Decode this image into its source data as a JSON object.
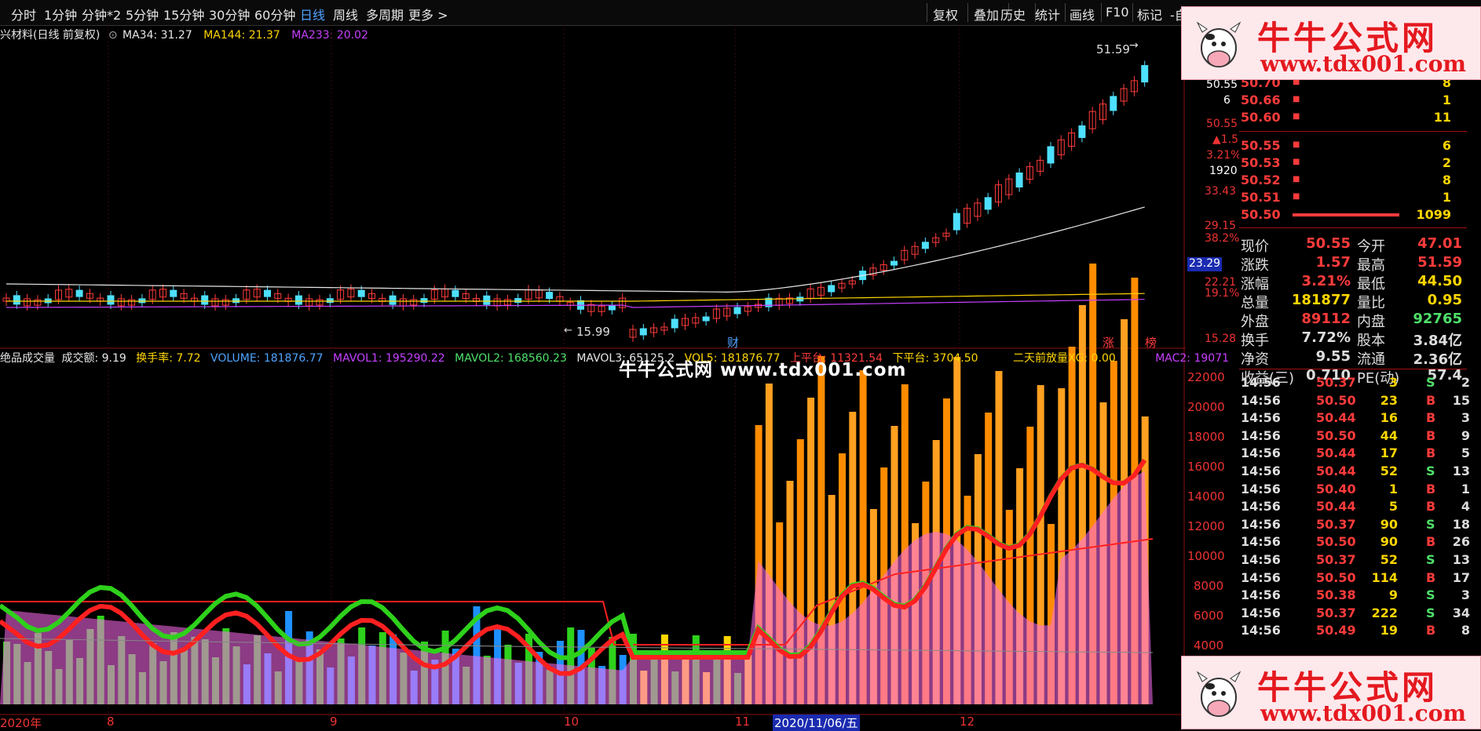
{
  "toolbar": {
    "timeframes": [
      "分时",
      "1分钟",
      "分钟*2",
      "5分钟",
      "15分钟",
      "30分钟",
      "60分钟",
      "日线",
      "周线",
      "多周期",
      "更多 >"
    ],
    "active_timeframe": "日线",
    "right_buttons": [
      "复权",
      "叠加",
      "历史",
      "统计",
      "画线",
      "F10",
      "标记",
      "-自"
    ]
  },
  "chart": {
    "stock_title": "兴材料(日线 前复权)",
    "ma34": "MA34: 31.27",
    "ma144": "MA144: 21.37",
    "ma233": "MA233: 20.02",
    "high_marker": "51.59",
    "low_marker": "15.99",
    "fin_marker": "财",
    "zhang_marker": "涨",
    "bang_marker": "榜",
    "price_axis": {
      "p1": "50.55",
      "p2": "6",
      "p3": "50.55",
      "p4": "▲1.57",
      "p5": "3.21%",
      "p6": "1920",
      "p7": "33.43",
      "p8": "29.15",
      "p9": "38.2%",
      "p10": "23.29",
      "p11": "22.21",
      "p12": "19.1%",
      "p13": "15.28"
    },
    "volume_info": {
      "name": "绝品成交量",
      "amount": "成交额: 9.19",
      "turnover": "换手率: 7.72",
      "volume": "VOLUME: 181876.77",
      "mavol1": "MAVOL1: 195290.22",
      "mavol2": "MAVOL2: 168560.23",
      "mavol3": "MAVOL3: 65125.2",
      "vol_extra": "VOL5: 181876.77",
      "upper_platform": "上平台: 11321.54",
      "lower_platform": "下平台: 3704.50",
      "xg": "二天前放量XG: 0.00",
      "mac2": "MAC2: 19071"
    },
    "vol_axis": [
      "22000",
      "20000",
      "18000",
      "16000",
      "14000",
      "12000",
      "10000",
      "8000",
      "6000",
      "4000"
    ],
    "x_axis": [
      "2020年",
      "8",
      "9",
      "10",
      "11",
      "2020/11/06/五",
      "12"
    ],
    "colors": {
      "up": "#ff3b3b",
      "down": "#4ee0ff",
      "ma34": "#e6e6e6",
      "ma144": "#ffd600",
      "ma233": "#c640ff"
    }
  },
  "orderbook": {
    "asks": [
      {
        "price": "50.70",
        "vol": "8"
      },
      {
        "price": "50.66",
        "vol": "1"
      },
      {
        "price": "50.60",
        "vol": "11"
      }
    ],
    "bids": [
      {
        "price": "50.55",
        "vol": "6"
      },
      {
        "price": "50.53",
        "vol": "2"
      },
      {
        "price": "50.52",
        "vol": "8"
      },
      {
        "price": "50.51",
        "vol": "1"
      },
      {
        "price": "50.50",
        "vol": "1099"
      }
    ]
  },
  "quote": [
    {
      "l": "现价",
      "v": "50.55",
      "vc": "#ff3b3b",
      "l2": "今开",
      "v2": "47.01",
      "v2c": "#ff3b3b"
    },
    {
      "l": "涨跌",
      "v": "1.57",
      "vc": "#ff3b3b",
      "l2": "最高",
      "v2": "51.59",
      "v2c": "#ff3b3b"
    },
    {
      "l": "涨幅",
      "v": "3.21%",
      "vc": "#ff3b3b",
      "l2": "最低",
      "v2": "44.50",
      "v2c": "#ffd600"
    },
    {
      "l": "总量",
      "v": "181877",
      "vc": "#ffd600",
      "l2": "量比",
      "v2": "0.95",
      "v2c": "#ffd600"
    },
    {
      "l": "外盘",
      "v": "89112",
      "vc": "#ff3b3b",
      "l2": "内盘",
      "v2": "92765",
      "v2c": "#4ee06a"
    },
    {
      "l": "换手",
      "v": "7.72%",
      "vc": "#ddd",
      "l2": "股本",
      "v2": "3.84亿",
      "v2c": "#ddd"
    },
    {
      "l": "净资",
      "v": "9.55",
      "vc": "#ddd",
      "l2": "流通",
      "v2": "2.36亿",
      "v2c": "#ddd"
    },
    {
      "l": "收益(三)",
      "v": "0.710",
      "vc": "#ddd",
      "l2": "PE(动)",
      "v2": "57.4",
      "v2c": "#ddd"
    }
  ],
  "ticks": [
    {
      "t": "14:56",
      "p": "50.37",
      "v": "3",
      "bs": "S",
      "n": "2"
    },
    {
      "t": "14:56",
      "p": "50.50",
      "v": "23",
      "bs": "B",
      "n": "15"
    },
    {
      "t": "14:56",
      "p": "50.44",
      "v": "16",
      "bs": "B",
      "n": "3"
    },
    {
      "t": "14:56",
      "p": "50.50",
      "v": "44",
      "bs": "B",
      "n": "9"
    },
    {
      "t": "14:56",
      "p": "50.44",
      "v": "17",
      "bs": "B",
      "n": "5"
    },
    {
      "t": "14:56",
      "p": "50.44",
      "v": "52",
      "bs": "S",
      "n": "13"
    },
    {
      "t": "14:56",
      "p": "50.40",
      "v": "1",
      "bs": "B",
      "n": "1"
    },
    {
      "t": "14:56",
      "p": "50.44",
      "v": "5",
      "bs": "B",
      "n": "4"
    },
    {
      "t": "14:56",
      "p": "50.37",
      "v": "90",
      "bs": "S",
      "n": "18"
    },
    {
      "t": "14:56",
      "p": "50.50",
      "v": "90",
      "bs": "B",
      "n": "26"
    },
    {
      "t": "14:56",
      "p": "50.37",
      "v": "52",
      "bs": "S",
      "n": "13"
    },
    {
      "t": "14:56",
      "p": "50.50",
      "v": "114",
      "bs": "B",
      "n": "17"
    },
    {
      "t": "14:56",
      "p": "50.38",
      "v": "9",
      "bs": "S",
      "n": "3"
    },
    {
      "t": "14:56",
      "p": "50.37",
      "v": "222",
      "bs": "S",
      "n": "34"
    },
    {
      "t": "14:56",
      "p": "50.49",
      "v": "19",
      "bs": "B",
      "n": "8"
    }
  ],
  "logo": {
    "cn": "牛牛公式网",
    "url": "www.tdx001.com"
  },
  "watermark": "牛牛公式网 www.tdx001.com"
}
